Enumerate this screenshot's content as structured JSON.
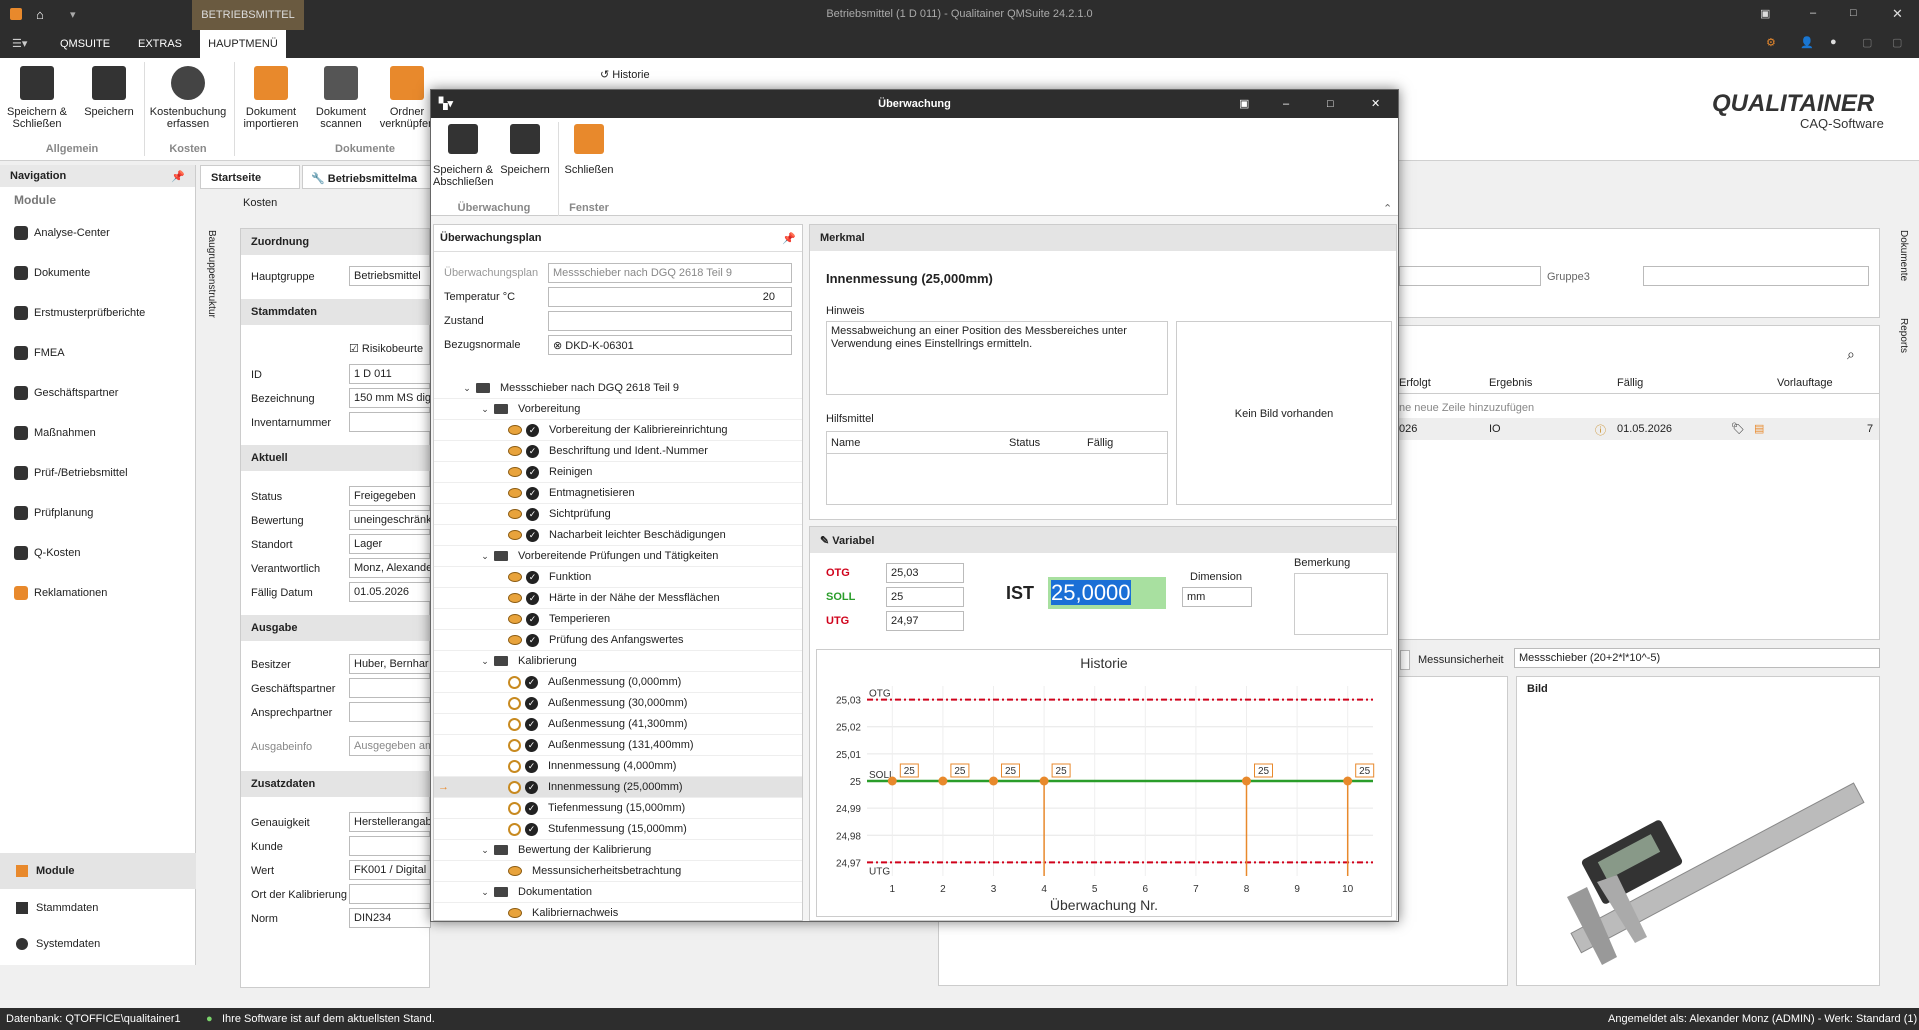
{
  "window": {
    "title": "Betriebsmittel (1 D 011) - Qualitainer QMSuite 24.2.1.0",
    "tab_context": "BETRIEBSMITTEL"
  },
  "menu": [
    "QMSUITE",
    "EXTRAS",
    "HAUPTMENÜ"
  ],
  "ribbon": {
    "buttons": [
      {
        "label": "Speichern &\nSchließen"
      },
      {
        "label": "Speichern"
      },
      {
        "label": "Kostenbuchung\nerfassen"
      },
      {
        "label": "Dokument\nimportieren"
      },
      {
        "label": "Dokument\nscannen"
      },
      {
        "label": "Ordner\nverknüpfen"
      }
    ],
    "groups": [
      "Allgemein",
      "Kosten",
      "Dokumente"
    ],
    "historie": "Historie",
    "brand": "QUALITAINER",
    "brand_sub": "CAQ-Software"
  },
  "navigation": {
    "title": "Navigation",
    "section": "Module",
    "items": [
      "Analyse-Center",
      "Dokumente",
      "Erstmusterprüfberichte",
      "FMEA",
      "Geschäftspartner",
      "Maßnahmen",
      "Prüf-/Betriebsmittel",
      "Prüfplanung",
      "Q-Kosten",
      "Reklamationen"
    ],
    "bottom": [
      "Module",
      "Stammdaten",
      "Systemdaten"
    ]
  },
  "tabs": [
    "Startseite",
    "Betriebsmittelma"
  ],
  "subtab": "Kosten",
  "side_label": "Baugruppenstruktur",
  "form": {
    "zuordnung": {
      "title": "Zuordnung",
      "hauptgruppe_label": "Hauptgruppe",
      "hauptgruppe": "Betriebsmittel"
    },
    "stammdaten": {
      "title": "Stammdaten",
      "risiko": "Risikobeurte",
      "id_label": "ID",
      "id": "1 D 011",
      "bez_label": "Bezeichnung",
      "bez": "150 mm MS digit",
      "inv_label": "Inventarnummer"
    },
    "aktuell": {
      "title": "Aktuell",
      "status_label": "Status",
      "status": "Freigegeben",
      "bew_label": "Bewertung",
      "bew": "uneingeschränk",
      "standort_label": "Standort",
      "standort": "Lager",
      "verantw_label": "Verantwortlich",
      "verantw": "Monz, Alexande",
      "faellig_label": "Fällig Datum",
      "faellig": "01.05.2026"
    },
    "ausgabe": {
      "title": "Ausgabe",
      "besitzer_label": "Besitzer",
      "besitzer": "Huber, Bernhar",
      "gp_label": "Geschäftspartner",
      "ap_label": "Ansprechpartner",
      "info_label": "Ausgabeinfo",
      "info": "Ausgegeben am"
    },
    "zusatz": {
      "title": "Zusatzdaten",
      "gen_label": "Genauigkeit",
      "gen": "Herstellerangab",
      "kunde_label": "Kunde",
      "wert_label": "Wert",
      "wert": "FK001 / Digital",
      "ort_label": "Ort der Kalibrierung",
      "norm_label": "Norm",
      "norm": "DIN234"
    }
  },
  "right_bg": {
    "gruppe3": "Gruppe3",
    "cols": [
      "Erfolgt",
      "Ergebnis",
      "Fällig",
      "Vorlauftage"
    ],
    "newrow": "ne neue Zeile hinzuzufügen",
    "row": [
      "026",
      "IO",
      "01.05.2026",
      "7"
    ],
    "messunsicherheit_label": "Messunsicherheit",
    "messunsicherheit": "Messschieber (20+2*l*10^-5)",
    "bild": "Bild",
    "side_tabs": [
      "Dokumente",
      "Reports"
    ]
  },
  "dialog": {
    "title": "Überwachung",
    "ribbon": [
      {
        "label": "Speichern &\nAbschließen"
      },
      {
        "label": "Speichern"
      },
      {
        "label": "Schließen"
      }
    ],
    "groups": [
      "Überwachung",
      "Fenster"
    ],
    "plan": {
      "title": "Überwachungsplan",
      "plan_label": "Überwachungsplan",
      "plan_value": "Messschieber nach DGQ 2618 Teil 9",
      "temp_label": "Temperatur °C",
      "temp_value": "20",
      "zustand_label": "Zustand",
      "bezug_label": "Bezugsnormale",
      "bezug_value": "DKD-K-06301"
    },
    "tree": [
      {
        "level": 0,
        "text": "Messschieber nach DGQ 2618 Teil 9",
        "kind": "root"
      },
      {
        "level": 1,
        "text": "Vorbereitung",
        "kind": "group"
      },
      {
        "level": 2,
        "text": "Vorbereitung der Kalibriereinrichtung",
        "kind": "eye"
      },
      {
        "level": 2,
        "text": "Beschriftung und Ident.-Nummer",
        "kind": "eye"
      },
      {
        "level": 2,
        "text": "Reinigen",
        "kind": "eye"
      },
      {
        "level": 2,
        "text": "Entmagnetisieren",
        "kind": "eye"
      },
      {
        "level": 2,
        "text": "Sichtprüfung",
        "kind": "eye"
      },
      {
        "level": 2,
        "text": "Nacharbeit leichter Beschädigungen",
        "kind": "eye"
      },
      {
        "level": 1,
        "text": "Vorbereitende Prüfungen und Tätigkeiten",
        "kind": "group"
      },
      {
        "level": 2,
        "text": "Funktion",
        "kind": "eye"
      },
      {
        "level": 2,
        "text": "Härte in der Nähe der Messflächen",
        "kind": "eye"
      },
      {
        "level": 2,
        "text": "Temperieren",
        "kind": "eye"
      },
      {
        "level": 2,
        "text": "Prüfung des Anfangswertes",
        "kind": "eye"
      },
      {
        "level": 1,
        "text": "Kalibrierung",
        "kind": "group"
      },
      {
        "level": 2,
        "text": "Außenmessung (0,000mm)",
        "kind": "cal"
      },
      {
        "level": 2,
        "text": "Außenmessung (30,000mm)",
        "kind": "cal"
      },
      {
        "level": 2,
        "text": "Außenmessung (41,300mm)",
        "kind": "cal"
      },
      {
        "level": 2,
        "text": "Außenmessung (131,400mm)",
        "kind": "cal"
      },
      {
        "level": 2,
        "text": "Innenmessung (4,000mm)",
        "kind": "cal"
      },
      {
        "level": 2,
        "text": "Innenmessung (25,000mm)",
        "kind": "cal",
        "selected": true
      },
      {
        "level": 2,
        "text": "Tiefenmessung (15,000mm)",
        "kind": "cal"
      },
      {
        "level": 2,
        "text": "Stufenmessung (15,000mm)",
        "kind": "cal"
      },
      {
        "level": 1,
        "text": "Bewertung der Kalibrierung",
        "kind": "group"
      },
      {
        "level": 2,
        "text": "Messunsicherheitsbetrachtung",
        "kind": "eye-only"
      },
      {
        "level": 1,
        "text": "Dokumentation",
        "kind": "group"
      },
      {
        "level": 2,
        "text": "Kalibriernachweis",
        "kind": "eye-only"
      }
    ],
    "merkmal": {
      "title": "Merkmal",
      "name": "Innenmessung (25,000mm)",
      "hinweis_label": "Hinweis",
      "hinweis": "Messabweichung an einer Position des Messbereiches unter Verwendung eines Einstellrings ermitteln.",
      "kein_bild": "Kein Bild vorhanden",
      "hilfsmittel_label": "Hilfsmittel",
      "hilfsmittel_cols": [
        "Name",
        "Status",
        "Fällig"
      ]
    },
    "variabel": {
      "title": "Variabel",
      "otg_label": "OTG",
      "otg": "25,03",
      "soll_label": "SOLL",
      "soll": "25",
      "utg_label": "UTG",
      "utg": "24,97",
      "ist_label": "IST",
      "ist": "25,0000",
      "dim_label": "Dimension",
      "dim": "mm",
      "bem_label": "Bemerkung"
    }
  },
  "chart_data": {
    "type": "line",
    "title": "Historie",
    "xlabel": "Überwachung Nr.",
    "x_ticks": [
      1,
      2,
      3,
      4,
      5,
      6,
      7,
      8,
      9,
      10
    ],
    "y_ticks": [
      "25,03",
      "25,02",
      "25,01",
      "25",
      "24,99",
      "24,98",
      "24,97"
    ],
    "ylim": [
      24.965,
      25.035
    ],
    "xlim": [
      0.5,
      10.5
    ],
    "limits": {
      "OTG": 25.03,
      "SOLL": 25,
      "UTG": 24.97
    },
    "points": [
      {
        "x": 1,
        "y": 25,
        "label": "25"
      },
      {
        "x": 2,
        "y": 25,
        "label": "25"
      },
      {
        "x": 3,
        "y": 25,
        "label": "25"
      },
      {
        "x": 4,
        "y": 25,
        "label": "25"
      },
      {
        "x": 8,
        "y": 25,
        "label": "25"
      },
      {
        "x": 10,
        "y": 25,
        "label": "25"
      }
    ],
    "drop_lines_at": [
      4,
      8,
      10
    ],
    "colors": {
      "limit": "#d0021b",
      "soll": "#2a9d2a",
      "point": "#e8892c"
    }
  },
  "statusbar": {
    "db": "Datenbank:  QTOFFICE\\qualitainer1",
    "msg": "Ihre Software ist auf dem aktuellsten Stand.",
    "user": "Angemeldet als: Alexander Monz (ADMIN) - Werk: Standard (1)"
  }
}
